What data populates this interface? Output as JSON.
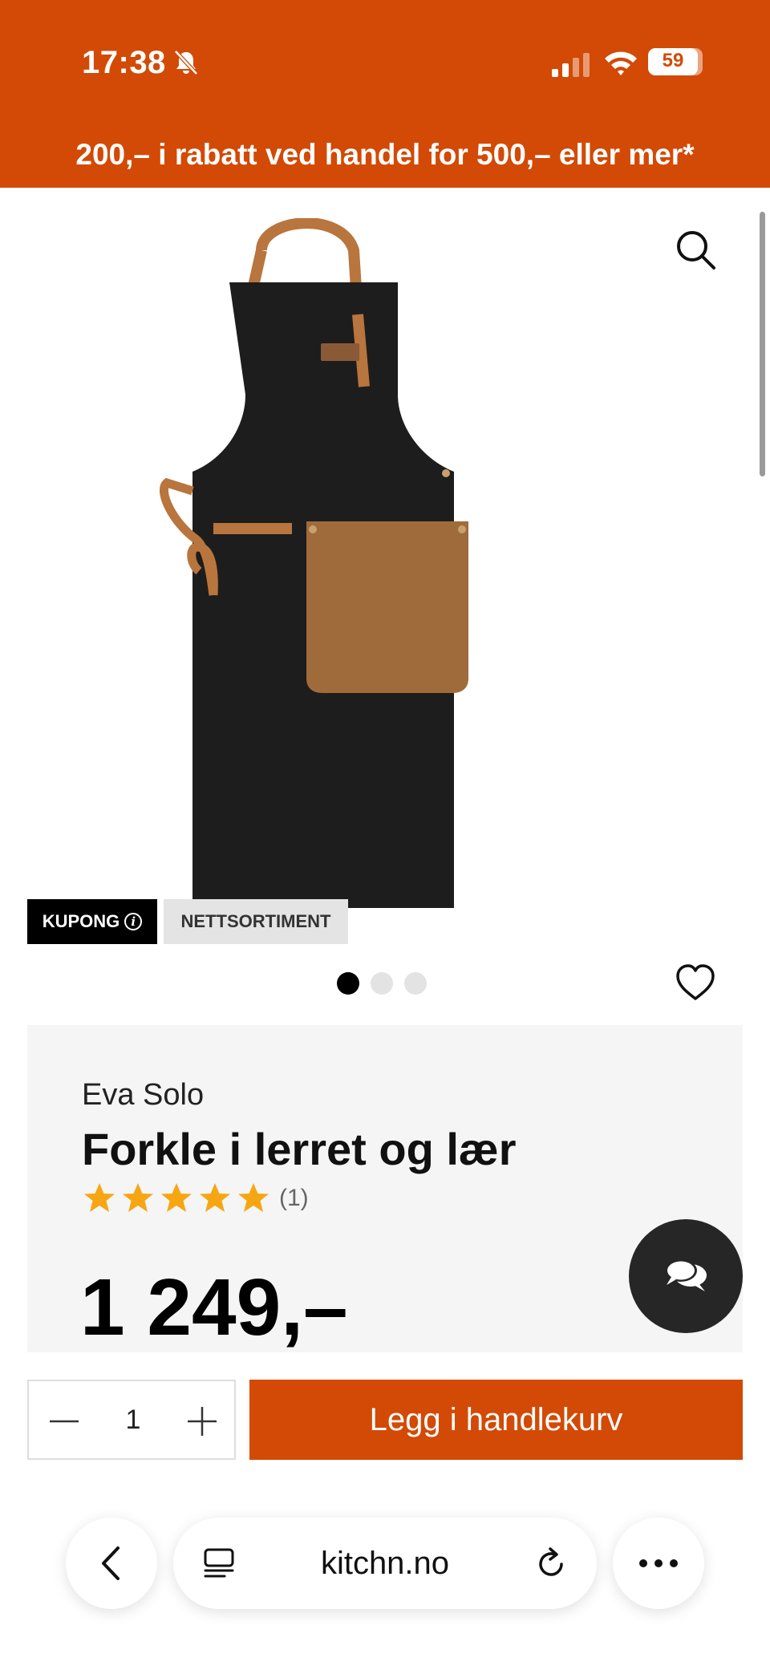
{
  "status_bar": {
    "time": "17:38",
    "battery": "59",
    "icons": [
      "bell-slash-icon",
      "signal-icon",
      "wifi-icon",
      "battery-icon"
    ]
  },
  "promo": {
    "text": "200,– i rabatt ved handel for 500,– eller mer*"
  },
  "gallery": {
    "image_subject": "apron",
    "badges": {
      "kupong": "KUPONG",
      "nettsortiment": "NETTSORTIMENT"
    },
    "dots_count": 3,
    "active_dot": 1
  },
  "product": {
    "brand": "Eva Solo",
    "title": "Forkle i lerret og lær",
    "rating": 5,
    "review_count": "(1)",
    "price": "1 249,–"
  },
  "cart": {
    "quantity": "1",
    "add_label": "Legg i handlekurv"
  },
  "browser": {
    "url": "kitchn.no"
  },
  "colors": {
    "brand_orange": "#d24a05",
    "star": "#f7a613",
    "panel_bg": "#f5f5f5",
    "chat_bg": "#262626"
  }
}
